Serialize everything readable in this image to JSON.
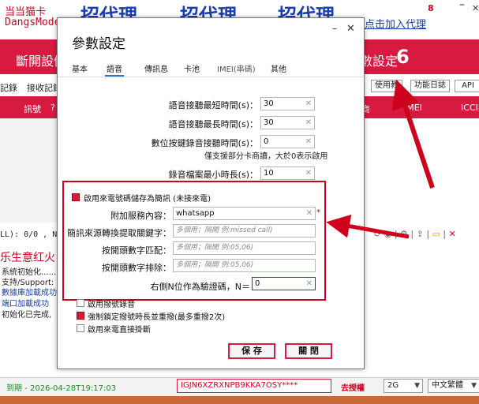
{
  "app": {
    "brand_line1": "当当猫卡",
    "brand_line2": "DangsMode",
    "promo_texts": [
      "招代理",
      "招代理",
      "招代理"
    ],
    "join_link": "点击加入代理",
    "corner_number": "8",
    "nav_left": "斷開設備",
    "nav_right": "數設定",
    "nav_right_number": "6",
    "sub_left1": "記錄",
    "sub_left2": "接收記錄",
    "buttons": [
      "使用教",
      "功能日誌",
      "API"
    ],
    "table_headers": [
      "訊號",
      "?",
      "商",
      "IMEI",
      "ICCID"
    ],
    "status_line": "LL): 0/0 , Num",
    "log_title": "乐生意红火",
    "log_lines": [
      "系統初始化......",
      "支持/Support:",
      "數據庫加載成功",
      "端口加載成功",
      "初始化已完成,"
    ],
    "expire": "到期 - 2026-04-28T19:17:03",
    "serial": "IGJN6XZRXNPB9KKA7OSY****",
    "promote": "去授權",
    "network_mode": "2G",
    "language": "中文繁體"
  },
  "dialog": {
    "title": "參數設定",
    "tabs": [
      "基本",
      "語音",
      "傳訊息",
      "卡池",
      "IMEI(串碼)",
      "其他"
    ],
    "active_tab_index": 1,
    "fields": [
      {
        "label": "語音接聽最短時間(s)：",
        "value": "30"
      },
      {
        "label": "語音接聽最長時間(s)：",
        "value": "30"
      },
      {
        "label": "數位按鍵錄音接聽時間(s)：",
        "value": "0"
      },
      {
        "label": "錄音檔案最小時長(s)：",
        "value": "10"
      }
    ],
    "note": "僅支援部分卡商讀，大於0表示啟用",
    "record_checkbox": {
      "label": "啟用來電號碼儲存為簡訊 (未接來電)",
      "checked": true
    },
    "service_label": "附加服務內容：",
    "service_value": "whatsapp",
    "keyword_label": "簡訊來源轉換提取關鍵字：",
    "keyword_placeholder": "多個用；隔開 例:missed call)",
    "match_label": "按開頭數字匹配：",
    "match_placeholder": "多個用；隔開 例:05,06)",
    "exclude_label": "按開頭數字排除：",
    "exclude_placeholder": "多個用；隔開 例:05,06)",
    "nright_label": "右側N位作為驗證碼，N＝",
    "nright_value": "0",
    "options": [
      {
        "label": "啟用撥號錄音",
        "checked": false
      },
      {
        "label": "強制鎖定撥號時長並重撥(最多重撥2次)",
        "checked": true
      },
      {
        "label": "啟用來電直接掛斷",
        "checked": false
      }
    ],
    "save_label": "保 存",
    "close_label": "關 閉"
  },
  "colors": {
    "accent": "#d71a40",
    "highlight": "#d0021b",
    "link": "#1a3fb0",
    "tab_underline": "#2f6fd1"
  }
}
